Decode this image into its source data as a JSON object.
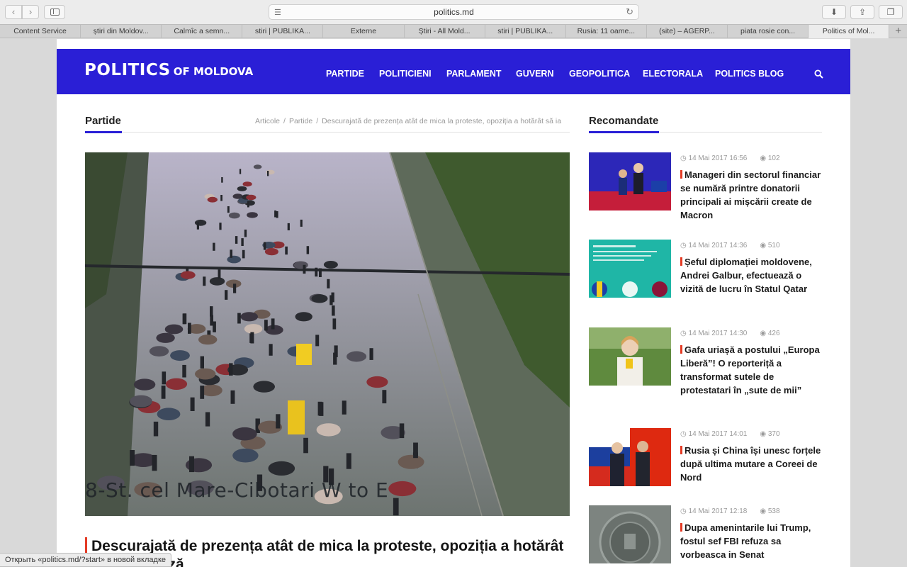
{
  "browser": {
    "url": "politics.md",
    "tabs": [
      "Content Service",
      "știri din Moldov...",
      "Calmîc a semn...",
      "stiri | PUBLIKA...",
      "Externe",
      "Știri - All Mold...",
      "stiri | PUBLIKA...",
      "Rusia: 11 oame...",
      "(site) – AGERP...",
      "piata rosie con...",
      "Politics of Mol..."
    ],
    "active_tab": 10,
    "status_tip": "Открыть «politics.md/?start» в новой вкладке"
  },
  "site": {
    "logo_main": "POLITICS",
    "logo_sub": "OF MOLDOVA",
    "brand_color": "#2a1fd6",
    "accent_color": "#e43b25",
    "nav": [
      "PARTIDE",
      "POLITICIENI",
      "PARLAMENT",
      "GUVERN",
      "GEOPOLITICA",
      "ELECTORALA",
      "POLITICS BLOG"
    ]
  },
  "article": {
    "section": "Partide",
    "breadcrumb": [
      "Articole",
      "Partide",
      "Descurajată de prezența atât de mica la proteste, opoziția a hotărât să ia"
    ],
    "image_caption": "8-St. cel Mare-Cibotari W to E",
    "title": "Descurajată de prezența atât de mica la proteste, opoziția a hotărât să ia o pauză"
  },
  "recommended": {
    "title": "Recomandate",
    "items": [
      {
        "date": "14 Mai 2017 16:56",
        "views": "102",
        "headline": "Manageri din sectorul financiar se numără printre donatorii principali ai mișcării create de Macron"
      },
      {
        "date": "14 Mai 2017 14:36",
        "views": "510",
        "headline": "Șeful diplomației moldovene, Andrei Galbur, efectuează o vizită de lucru în Statul Qatar"
      },
      {
        "date": "14 Mai 2017 14:30",
        "views": "426",
        "headline": "Gafa uriașă a postului „Europa Liberă”! O reporteriță a transformat sutele de protestatari în „sute de mii”"
      },
      {
        "date": "14 Mai 2017 14:01",
        "views": "370",
        "headline": "Rusia și China își unesc forțele după ultima mutare a Coreei de Nord"
      },
      {
        "date": "14 Mai 2017 12:18",
        "views": "538",
        "headline": "Dupa amenintarile lui Trump, fostul sef FBI refuza sa vorbeasca in Senat"
      }
    ]
  }
}
